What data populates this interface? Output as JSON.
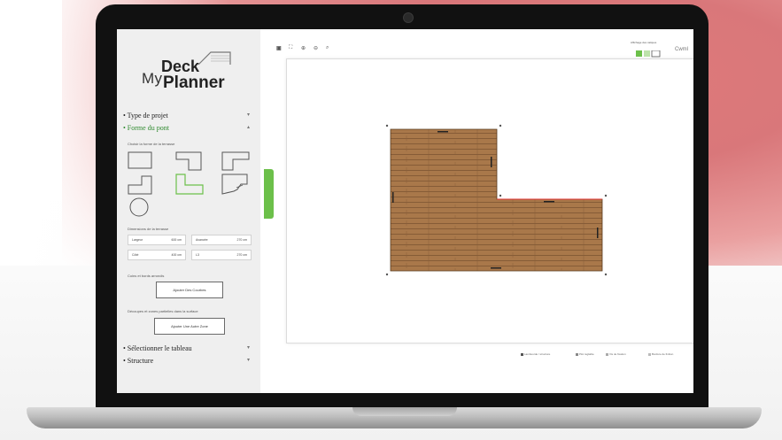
{
  "app": {
    "logo": {
      "my": "My",
      "deck": "Deck",
      "planner": "Planner"
    }
  },
  "sidebar": {
    "sections": [
      {
        "label": "• Type de projet"
      },
      {
        "label": "• Forme du pont"
      },
      {
        "label": "• Sélectionner le tableau"
      },
      {
        "label": "• Structure"
      }
    ],
    "shape_hint": "Choisir la forme de la terrasse",
    "dimensions_title": "Dimensions de la terrasse",
    "dimensions": [
      {
        "label": "Largeur",
        "value": "600 cm"
      },
      {
        "label": "Avancée",
        "value": "270 cm"
      },
      {
        "label": "Côté",
        "value": "400 cm"
      },
      {
        "label": "L3",
        "value": "270 cm"
      }
    ],
    "corners_title": "Coins et bords arrondis",
    "corners_button": "Ajouter Des Courbes",
    "cutouts_title": "Découpes et zones partielles dans la surface",
    "cutouts_button": "Ajouter Une Autre Zone"
  },
  "canvas": {
    "top_right_label": "Affichage des calques",
    "top_right_text": "Cwml",
    "deck_color": "#a9784a",
    "legend": [
      {
        "label": "Lambourde / structure",
        "color": "#555555"
      },
      {
        "label": "Plot réglable",
        "color": "#888888"
      },
      {
        "label": "Vis de fixation",
        "color": "#aaaaaa"
      },
      {
        "label": "Bordure de finition",
        "color": "#bbbbbb"
      }
    ]
  },
  "colors": {
    "accent": "#6cc04a",
    "sidebar_bg": "#efefef"
  }
}
